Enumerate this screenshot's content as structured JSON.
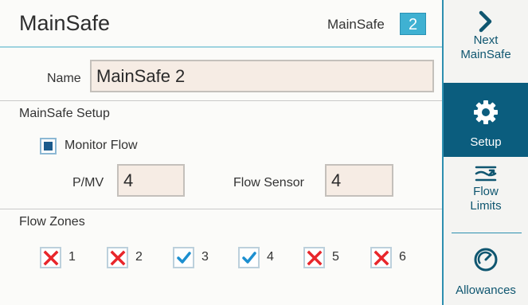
{
  "header": {
    "title": "MainSafe",
    "selector_label": "MainSafe",
    "selector_value": "2"
  },
  "name_field": {
    "label": "Name",
    "value": "MainSafe 2"
  },
  "setup": {
    "title": "MainSafe Setup",
    "monitor_flow": {
      "label": "Monitor Flow",
      "checked": true
    },
    "pmv": {
      "label": "P/MV",
      "value": "4"
    },
    "flow_sensor": {
      "label": "Flow Sensor",
      "value": "4"
    }
  },
  "flow_zones": {
    "title": "Flow Zones",
    "zones": [
      {
        "num": "1",
        "state": "excluded"
      },
      {
        "num": "2",
        "state": "excluded"
      },
      {
        "num": "3",
        "state": "included"
      },
      {
        "num": "4",
        "state": "included"
      },
      {
        "num": "5",
        "state": "excluded"
      },
      {
        "num": "6",
        "state": "excluded"
      }
    ]
  },
  "sidebar": {
    "next": {
      "line1": "Next",
      "line2": "MainSafe",
      "icon": "chevron-right-icon"
    },
    "setup": {
      "label": "Setup",
      "icon": "gear-icon",
      "active": true
    },
    "flow_limits": {
      "line1": "Flow",
      "line2": "Limits",
      "icon": "flow-limits-icon"
    },
    "allowances": {
      "label": "Allowances",
      "icon": "gauge-icon"
    }
  },
  "colors": {
    "accent": "#3fb1d2",
    "sidebar_active": "#0b5d7e",
    "x_mark": "#e8262b",
    "check_mark": "#1c8fd0",
    "input_bg": "#f6ece4"
  }
}
